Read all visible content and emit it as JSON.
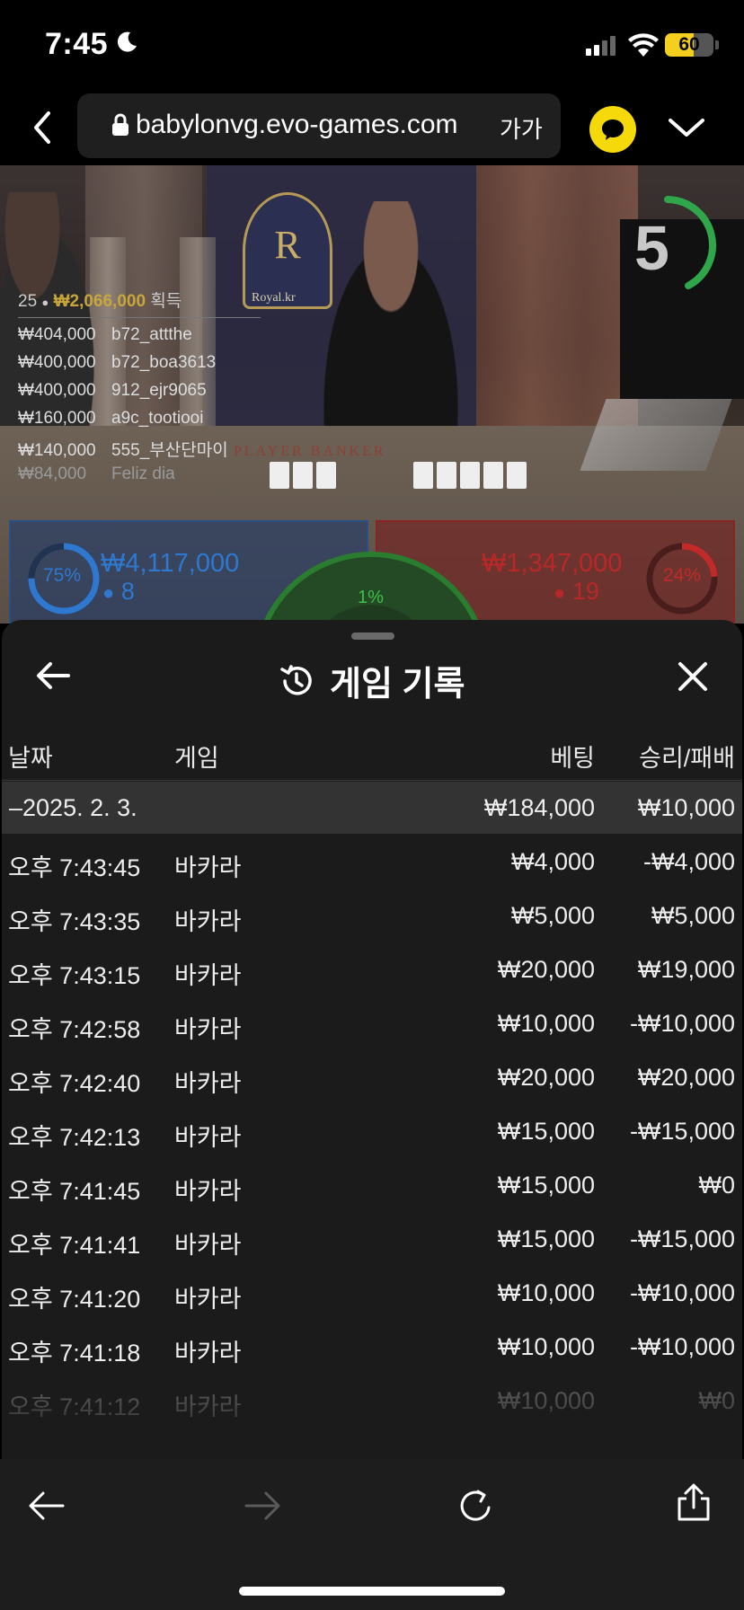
{
  "status_bar": {
    "time": "7:45",
    "battery": "60",
    "battery_level": 0.6,
    "icons": [
      "moon-icon",
      "cellular-signal-icon",
      "wifi-icon",
      "battery-icon"
    ]
  },
  "browser": {
    "url": "babylonvg.evo-games.com",
    "text_size_label": "가가",
    "icons": [
      "back-chevron-icon",
      "lock-icon",
      "chat-bubble-icon",
      "chevron-down-icon"
    ],
    "accent_color": "#f5d90a"
  },
  "game": {
    "timer": "5",
    "crest_letter": "R",
    "crest_label": "Royal.kr",
    "table_banner": "PLAYER   BANKER",
    "winners": {
      "count": "25",
      "total": "₩2,066,000",
      "label": "획득",
      "list": [
        {
          "amount": "₩404,000",
          "name": "b72_attthe"
        },
        {
          "amount": "₩400,000",
          "name": "b72_boa3613"
        },
        {
          "amount": "₩400,000",
          "name": "912_ejr9065"
        },
        {
          "amount": "₩160,000",
          "name": "a9c_tootiooi"
        },
        {
          "amount": "₩140,000",
          "name": "555_부산단마이"
        },
        {
          "amount": "₩84,000",
          "name": "Feliz dia"
        }
      ]
    },
    "player_bets": {
      "percent": "75%",
      "percent_value": 0.75,
      "amount": "₩4,117,000",
      "count": "8",
      "color": "#2f78d0"
    },
    "banker_bets": {
      "percent": "24%",
      "percent_value": 0.24,
      "amount": "₩1,347,000",
      "count": "19",
      "color": "#c22a2a"
    },
    "tie_bets": {
      "percent": "1%",
      "color": "#3ec04a"
    }
  },
  "history": {
    "title": "게임 기록",
    "columns": {
      "date": "날짜",
      "game": "게임",
      "bet": "베팅",
      "result": "승리/패배"
    },
    "date_group": {
      "date": "–2025. 2. 3.",
      "bet_total": "₩184,000",
      "result_total": "₩10,000"
    },
    "rows": [
      {
        "time": "오후 7:43:45",
        "game": "바카라",
        "bet": "₩4,000",
        "result": "-₩4,000"
      },
      {
        "time": "오후 7:43:35",
        "game": "바카라",
        "bet": "₩5,000",
        "result": "₩5,000"
      },
      {
        "time": "오후 7:43:15",
        "game": "바카라",
        "bet": "₩20,000",
        "result": "₩19,000"
      },
      {
        "time": "오후 7:42:58",
        "game": "바카라",
        "bet": "₩10,000",
        "result": "-₩10,000"
      },
      {
        "time": "오후 7:42:40",
        "game": "바카라",
        "bet": "₩20,000",
        "result": "₩20,000"
      },
      {
        "time": "오후 7:42:13",
        "game": "바카라",
        "bet": "₩15,000",
        "result": "-₩15,000"
      },
      {
        "time": "오후 7:41:45",
        "game": "바카라",
        "bet": "₩15,000",
        "result": "₩0"
      },
      {
        "time": "오후 7:41:41",
        "game": "바카라",
        "bet": "₩15,000",
        "result": "-₩15,000"
      },
      {
        "time": "오후 7:41:20",
        "game": "바카라",
        "bet": "₩10,000",
        "result": "-₩10,000"
      },
      {
        "time": "오후 7:41:18",
        "game": "바카라",
        "bet": "₩10,000",
        "result": "-₩10,000"
      },
      {
        "time": "오후 7:41:12",
        "game": "바카라",
        "bet": "₩10,000",
        "result": "₩0"
      }
    ]
  },
  "toolbar": {
    "icons": [
      "back-arrow-icon",
      "forward-arrow-icon",
      "reload-icon",
      "share-icon"
    ]
  }
}
